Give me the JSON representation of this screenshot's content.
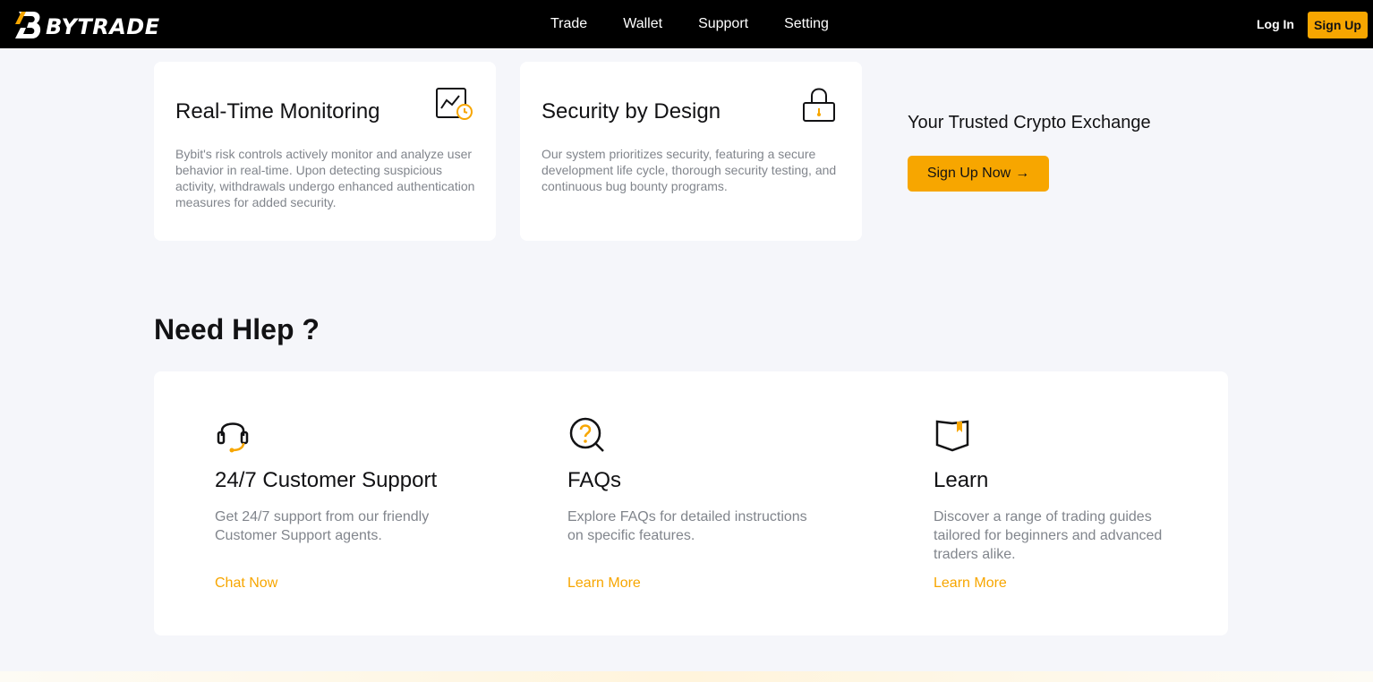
{
  "header": {
    "logo_text": "BYTRADE",
    "nav": [
      "Trade",
      "Wallet",
      "Support",
      "Setting"
    ],
    "login_label": "Log In",
    "signup_label": "Sign Up"
  },
  "features": [
    {
      "title": "Real-Time Monitoring",
      "description": "Bybit's risk controls actively monitor and analyze user behavior in real-time. Upon detecting suspicious activity, withdrawals undergo enhanced authentication measures for added security.",
      "icon": "chart-monitor-icon"
    },
    {
      "title": "Security by Design",
      "description": "Our system prioritizes security, featuring a secure development life cycle, thorough security testing, and continuous bug bounty programs.",
      "icon": "lock-icon"
    }
  ],
  "cta": {
    "title": "Your Trusted Crypto Exchange",
    "button_label": "Sign Up Now",
    "button_arrow": "→"
  },
  "help": {
    "title": "Need Hlep ?",
    "items": [
      {
        "title": "24/7 Customer Support",
        "description": "Get 24/7 support from our friendly Customer Support agents.",
        "link": "Chat Now",
        "icon": "headset-icon"
      },
      {
        "title": "FAQs",
        "description": "Explore FAQs for detailed instructions on specific features.",
        "link": "Learn More",
        "icon": "faq-search-icon"
      },
      {
        "title": "Learn",
        "description": "Discover a range of trading guides tailored for beginners and advanced traders alike.",
        "link": "Learn More",
        "icon": "book-icon"
      }
    ]
  },
  "colors": {
    "accent": "#f7a600",
    "header_bg": "#000000",
    "page_bg": "#f5f6fa",
    "muted_text": "#81858c"
  }
}
